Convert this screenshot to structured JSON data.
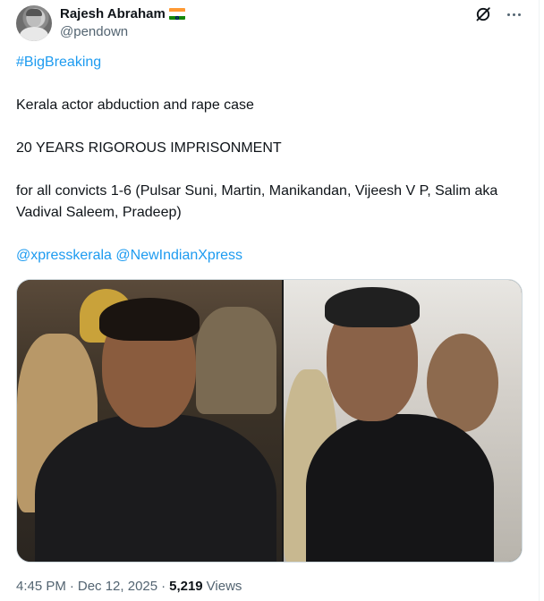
{
  "author": {
    "display_name": "Rajesh Abraham",
    "handle": "@pendown",
    "flag_icon": "india-flag-emoji"
  },
  "icons": {
    "grok": "grok-slash-circle-icon",
    "more": "more-horizontal-icon"
  },
  "tweet": {
    "hashtag": "#BigBreaking",
    "line1": "Kerala actor abduction and rape case",
    "line2": "20 YEARS RIGOROUS IMPRISONMENT",
    "line3": "for all convicts 1-6 (Pulsar Suni, Martin, Manikandan, Vijeesh V P, Salim aka Vadival Saleem, Pradeep)",
    "mention1": "@xpresskerala",
    "mention2": "@NewIndianXpress"
  },
  "meta": {
    "time": "4:45 PM",
    "separator": "·",
    "date": "Dec 12, 2025",
    "views_count": "5,219",
    "views_label": "Views"
  },
  "colors": {
    "link": "#1d9bf0",
    "text": "#0f1419",
    "secondary": "#536471"
  }
}
